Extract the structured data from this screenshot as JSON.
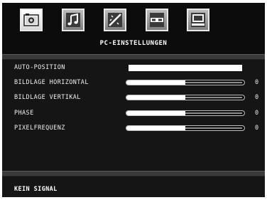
{
  "menu_title": "PC-EINSTELLUNGEN",
  "tabs": [
    {
      "icon": "picture-icon",
      "active": true
    },
    {
      "icon": "sound-icon",
      "active": false
    },
    {
      "icon": "feature-icon",
      "active": false
    },
    {
      "icon": "install-icon",
      "active": false
    },
    {
      "icon": "pc-icon",
      "active": false
    }
  ],
  "items": [
    {
      "label": "AUTO-POSITION"
    },
    {
      "label": "BILDLAGE HORIZONTAL",
      "value": "0",
      "level": 0.5
    },
    {
      "label": "BILDLAGE VERTIKAL",
      "value": "0",
      "level": 0.5
    },
    {
      "label": "PHASE",
      "value": "0",
      "level": 0.5
    },
    {
      "label": "PIXELFREQUENZ",
      "value": "0",
      "level": 0.5
    }
  ],
  "status": "KEIN SIGNAL",
  "colors": {
    "background": "#151515",
    "text": "#f0f0f0",
    "slider_fill": "#ffffff"
  }
}
